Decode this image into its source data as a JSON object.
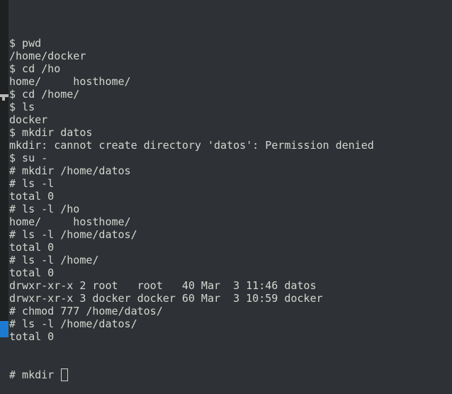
{
  "terminal": {
    "lines": [
      "$ pwd",
      "/home/docker",
      "$ cd /ho",
      "home/     hosthome/",
      "$ cd /home/",
      "$ ls",
      "docker",
      "$ mkdir datos",
      "mkdir: cannot create directory 'datos': Permission denied",
      "$ su -",
      "# mkdir /home/datos",
      "# ls -l",
      "total 0",
      "# ls -l /ho",
      "home/     hosthome/",
      "# ls -l /home/datos/",
      "total 0",
      "# ls -l /home/",
      "total 0",
      "drwxr-xr-x 2 root   root   40 Mar  3 11:46 datos",
      "drwxr-xr-x 3 docker docker 60 Mar  3 10:59 docker",
      "# chmod 777 /home/datos/",
      "# ls -l /home/datos/",
      "total 0"
    ],
    "prompt_line": "# mkdir "
  },
  "colors": {
    "background": "#2e3236",
    "text": "#d3d7cf",
    "accent": "#1c7bd0"
  }
}
